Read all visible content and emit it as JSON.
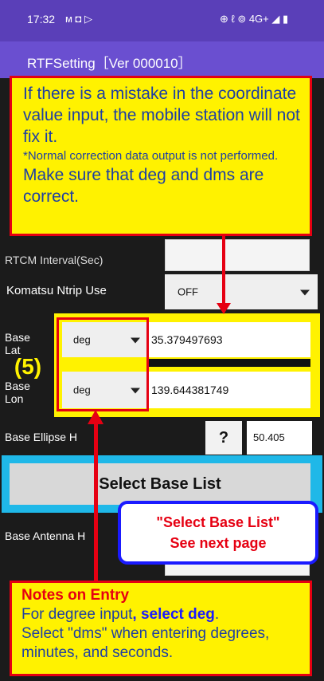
{
  "status_bar": {
    "time": "17:32",
    "left_icons": "ᴍ ◘ ▷",
    "right_icons": "⊕ ℓ ⊚ 4G+ ◢ ▮"
  },
  "app": {
    "title": "RTFSetting［Ver 000010］"
  },
  "rows": {
    "rtcm_interval_label": "RTCM Interval(Sec)",
    "komatsu_label": "Komatsu Ntrip Use",
    "komatsu_value": "OFF",
    "base_lat_label_1": "Base",
    "base_lat_label_2": "Lat",
    "base_lat_unit": "deg",
    "base_lat_value": "35.379497693",
    "base_lon_label_1": "Base",
    "base_lon_label_2": "Lon",
    "base_lon_unit": "deg",
    "base_lon_value": "139.644381749",
    "ellipse_label": "Base Ellipse H",
    "ellipse_help": "?",
    "ellipse_value": "50.405",
    "select_base_button": "Select Base List",
    "antenna_label": "Base Antenna H"
  },
  "annotations": {
    "marker": "(5)",
    "top_callout": {
      "line1": "If there is a mistake in the coordinate value input, the mobile station will not fix it.",
      "line2": "*Normal correction data output is not performed.",
      "line3": "Make sure that deg and dms are correct."
    },
    "select_callout": {
      "line1": "\"Select Base List\"",
      "line2": "See next page"
    },
    "bottom_callout": {
      "title": "Notes on Entry",
      "line1_a": "For degree input",
      "line1_b": ", select deg",
      "line1_c": ".",
      "line2": "Select \"dms\" when entering degrees, minutes, and seconds."
    }
  },
  "colors": {
    "status_bar": "#5a3fb8",
    "title_bar": "#6a4fd0",
    "callout_fill": "#fff200",
    "callout_border": "#e60012",
    "callout_text": "#1e3fa3",
    "highlight_cyan": "#1fb8e8",
    "note_box_border": "#1a1aff"
  }
}
